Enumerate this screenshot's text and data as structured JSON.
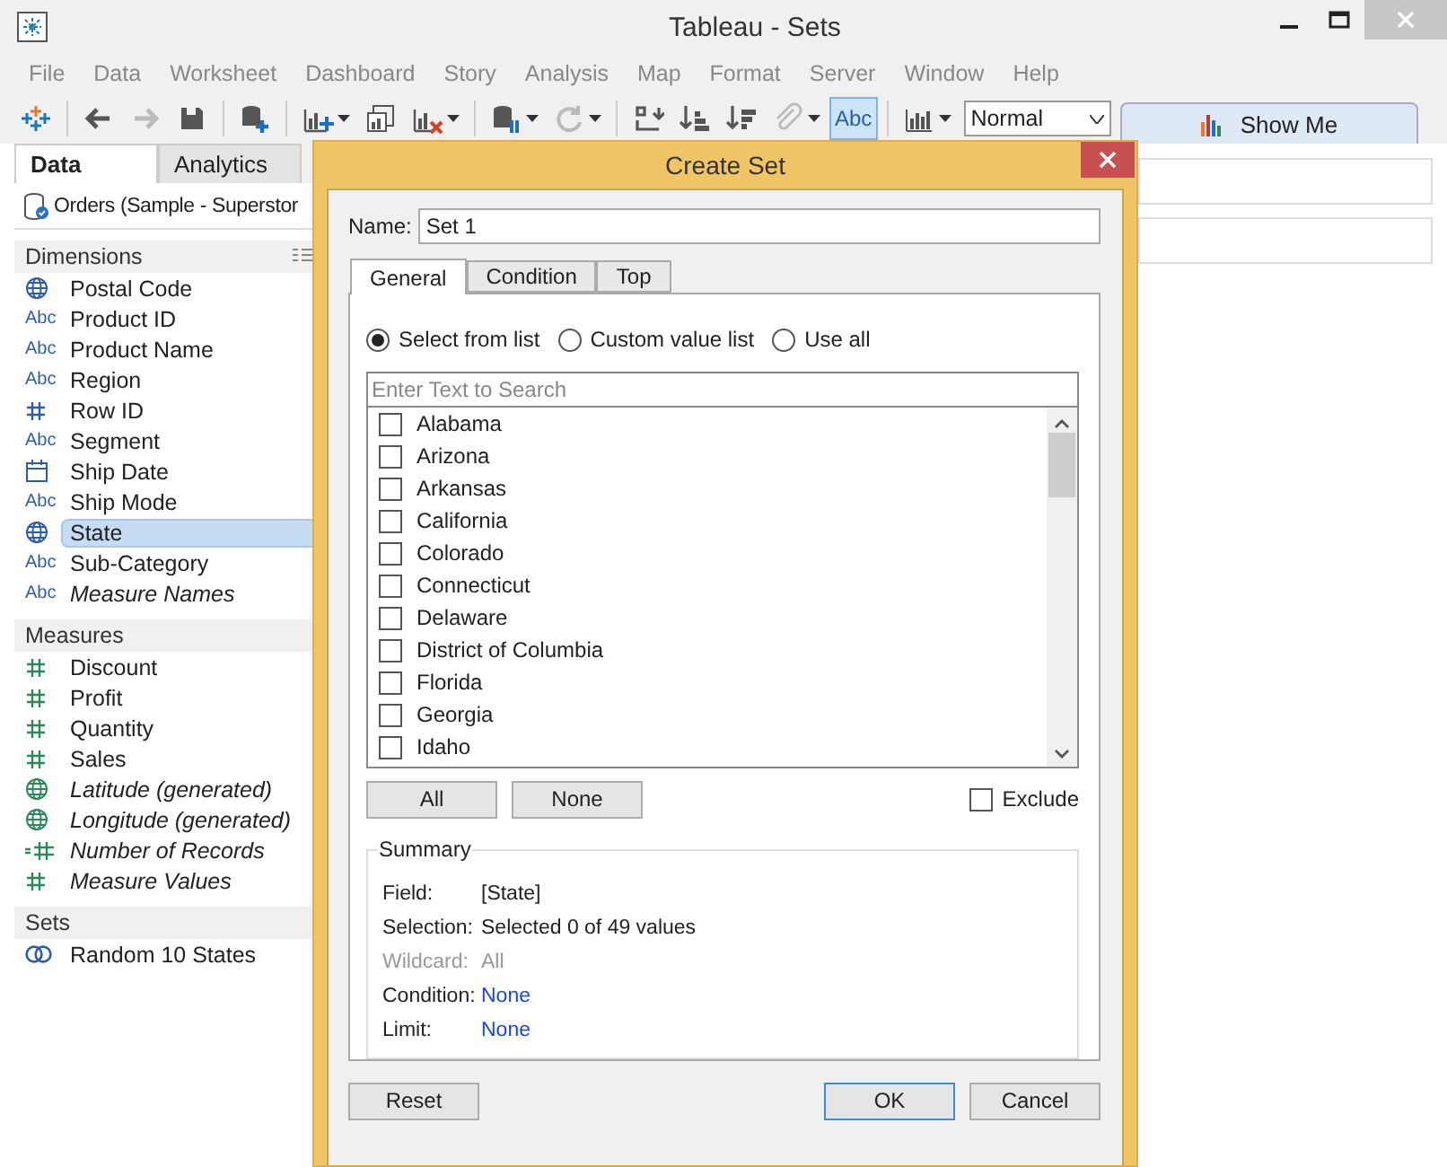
{
  "window": {
    "title": "Tableau - Sets"
  },
  "menu": [
    "File",
    "Data",
    "Worksheet",
    "Dashboard",
    "Story",
    "Analysis",
    "Map",
    "Format",
    "Server",
    "Window",
    "Help"
  ],
  "toolbar": [
    {
      "kind": "logo"
    },
    {
      "kind": "separator"
    },
    {
      "kind": "back",
      "disabled": false
    },
    {
      "kind": "forward",
      "disabled": true
    },
    {
      "kind": "save",
      "disabled": false
    },
    {
      "kind": "separator"
    },
    {
      "kind": "add-data",
      "disabled": false
    },
    {
      "kind": "separator"
    },
    {
      "kind": "new-sheet",
      "disabled": false,
      "caret": true
    },
    {
      "kind": "duplicate",
      "disabled": false
    },
    {
      "kind": "clear",
      "disabled": false,
      "caret": true
    },
    {
      "kind": "separator"
    },
    {
      "kind": "pause",
      "disabled": false,
      "caret": true
    },
    {
      "kind": "refresh",
      "disabled": true,
      "caret": true
    },
    {
      "kind": "separator"
    },
    {
      "kind": "swap",
      "disabled": false
    },
    {
      "kind": "sort-asc",
      "disabled": false
    },
    {
      "kind": "sort-desc",
      "disabled": false
    },
    {
      "kind": "clip",
      "disabled": true,
      "caret": true
    },
    {
      "kind": "labels",
      "label": "Abc",
      "selected": true
    },
    {
      "kind": "separator"
    },
    {
      "kind": "bars",
      "disabled": false,
      "caret": true
    }
  ],
  "fit_select": {
    "value": "Normal"
  },
  "show_me": {
    "label": "Show Me"
  },
  "sidebar": {
    "tabs": [
      {
        "label": "Data",
        "selected": true
      },
      {
        "label": "Analytics",
        "selected": false
      }
    ],
    "data_source": "Orders (Sample - Superstor",
    "sections": [
      {
        "title": "Dimensions",
        "fields": [
          {
            "name": "Postal Code",
            "kind": "globe",
            "generated": false,
            "selected": false
          },
          {
            "name": "Product ID",
            "kind": "abc",
            "label": "Abc",
            "generated": false,
            "selected": false
          },
          {
            "name": "Product Name",
            "kind": "abc",
            "label": "Abc",
            "generated": false,
            "selected": false
          },
          {
            "name": "Region",
            "kind": "abc",
            "label": "Abc",
            "generated": false,
            "selected": false
          },
          {
            "name": "Row ID",
            "kind": "hash",
            "generated": false,
            "selected": false
          },
          {
            "name": "Segment",
            "kind": "abc",
            "label": "Abc",
            "generated": false,
            "selected": false
          },
          {
            "name": "Ship Date",
            "kind": "calendar",
            "generated": false,
            "selected": false
          },
          {
            "name": "Ship Mode",
            "kind": "abc",
            "label": "Abc",
            "generated": false,
            "selected": false
          },
          {
            "name": "State",
            "kind": "globe",
            "generated": false,
            "selected": true
          },
          {
            "name": "Sub-Category",
            "kind": "abc",
            "label": "Abc",
            "generated": false,
            "selected": false
          },
          {
            "name": "Measure Names",
            "kind": "abc",
            "label": "Abc",
            "generated": true,
            "selected": false
          }
        ]
      },
      {
        "title": "Measures",
        "fields": [
          {
            "name": "Discount",
            "kind": "hash",
            "generated": false,
            "selected": false
          },
          {
            "name": "Profit",
            "kind": "hash",
            "generated": false,
            "selected": false
          },
          {
            "name": "Quantity",
            "kind": "hash",
            "generated": false,
            "selected": false
          },
          {
            "name": "Sales",
            "kind": "hash",
            "generated": false,
            "selected": false
          },
          {
            "name": "Latitude (generated)",
            "kind": "globe",
            "generated": true,
            "selected": false
          },
          {
            "name": "Longitude (generated)",
            "kind": "globe",
            "generated": true,
            "selected": false
          },
          {
            "name": "Number of Records",
            "kind": "hash-calc",
            "generated": true,
            "selected": false
          },
          {
            "name": "Measure Values",
            "kind": "hash",
            "generated": true,
            "selected": false
          }
        ]
      },
      {
        "title": "Sets",
        "fields": [
          {
            "name": "Random 10 States",
            "kind": "set",
            "generated": false,
            "selected": false
          }
        ]
      }
    ]
  },
  "dialog": {
    "title": "Create Set",
    "name_label": "Name:",
    "name_value": "Set 1",
    "tabs": [
      {
        "label": "General",
        "selected": true
      },
      {
        "label": "Condition",
        "selected": false
      },
      {
        "label": "Top",
        "selected": false
      }
    ],
    "modes": [
      {
        "label": "Select from list",
        "selected": true
      },
      {
        "label": "Custom value list",
        "selected": false
      },
      {
        "label": "Use all",
        "selected": false
      }
    ],
    "search": {
      "placeholder": "Enter Text to Search"
    },
    "values": [
      {
        "label": "Alabama",
        "checked": false
      },
      {
        "label": "Arizona",
        "checked": false
      },
      {
        "label": "Arkansas",
        "checked": false
      },
      {
        "label": "California",
        "checked": false
      },
      {
        "label": "Colorado",
        "checked": false
      },
      {
        "label": "Connecticut",
        "checked": false
      },
      {
        "label": "Delaware",
        "checked": false
      },
      {
        "label": "District of Columbia",
        "checked": false
      },
      {
        "label": "Florida",
        "checked": false
      },
      {
        "label": "Georgia",
        "checked": false
      },
      {
        "label": "Idaho",
        "checked": false
      }
    ],
    "list_buttons": [
      "All",
      "None"
    ],
    "exclude": {
      "label": "Exclude",
      "checked": false
    },
    "summary": {
      "title": "Summary",
      "rows": [
        {
          "label": "Field:",
          "value": "[State]",
          "kind": "text",
          "disabled": false
        },
        {
          "label": "Selection:",
          "value": "Selected 0 of 49 values",
          "kind": "text",
          "disabled": false
        },
        {
          "label": "Wildcard:",
          "value": "All",
          "kind": "text",
          "disabled": true
        },
        {
          "label": "Condition:",
          "value": "None",
          "kind": "link",
          "disabled": false
        },
        {
          "label": "Limit:",
          "value": "None",
          "kind": "link",
          "disabled": false
        }
      ]
    },
    "buttons": [
      {
        "label": "Reset",
        "default": false
      },
      {
        "label": "OK",
        "default": true
      },
      {
        "label": "Cancel",
        "default": false
      }
    ]
  }
}
